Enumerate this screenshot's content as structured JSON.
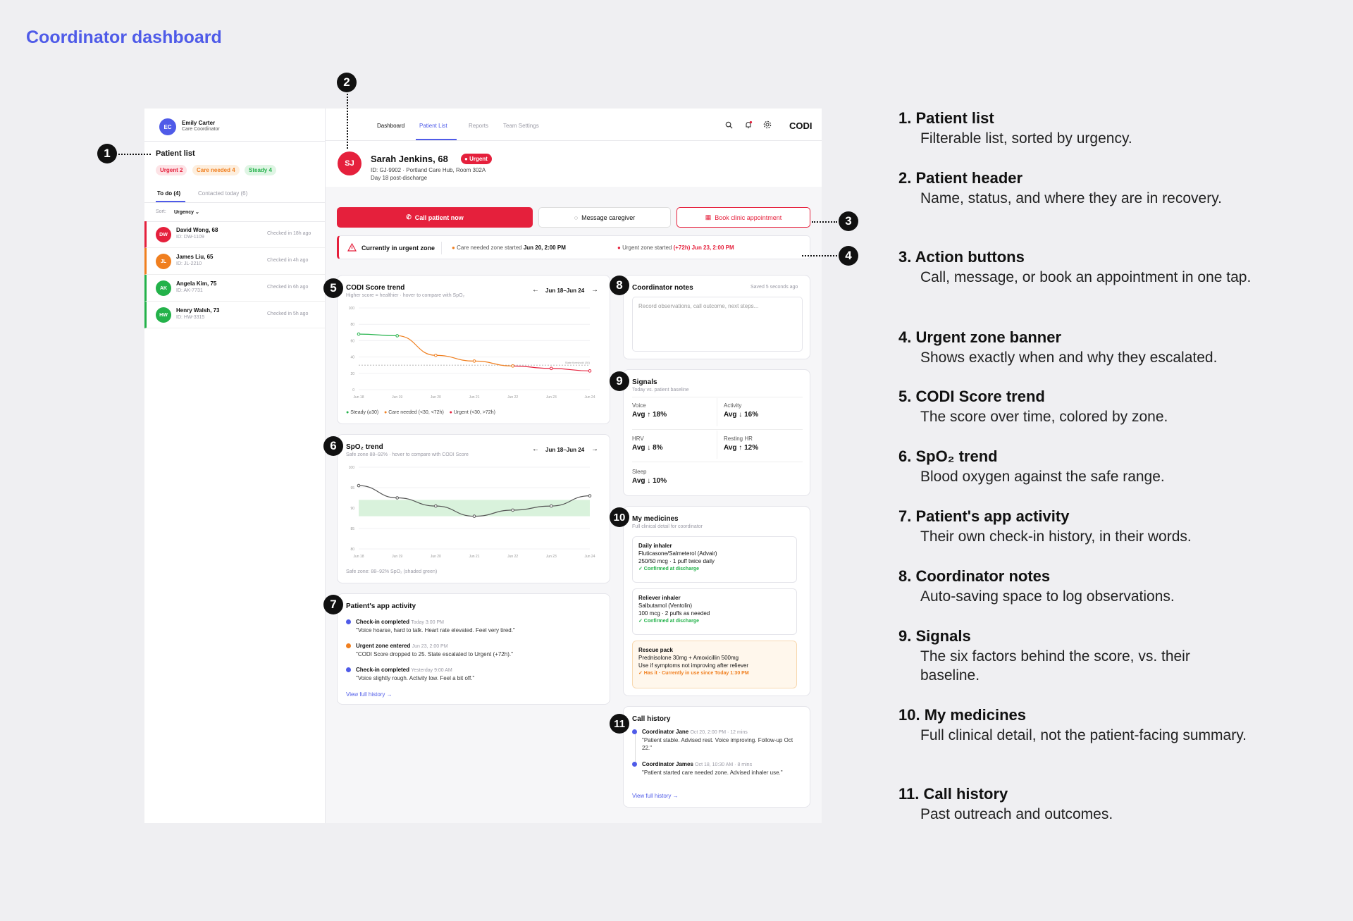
{
  "page_title": "Coordinator dashboard",
  "user": {
    "initials": "EC",
    "name": "Emily Carter",
    "role": "Care Coordinator"
  },
  "nav": {
    "tabs": [
      "Dashboard",
      "Patient List",
      "Reports",
      "Team Settings"
    ],
    "brand": "CODI"
  },
  "sidebar": {
    "title": "Patient list",
    "filters": [
      "Urgent 2",
      "Care needed 4",
      "Steady 4"
    ],
    "tabs": [
      "To do (4)",
      "Contacted today (6)"
    ],
    "sort_label": "Sort:",
    "sort_value": "Urgency",
    "patients": [
      {
        "initials": "DW",
        "name": "David Wong, 68",
        "id": "ID: DW-1109",
        "checked": "Checked in 18h ago",
        "color": "#e5203c"
      },
      {
        "initials": "JL",
        "name": "James Liu, 65",
        "id": "ID: JL-2210",
        "checked": "Checked in 4h ago",
        "color": "#f07f1f"
      },
      {
        "initials": "AK",
        "name": "Angela Kim, 75",
        "id": "ID: AK-7731",
        "checked": "Checked in 6h ago",
        "color": "#23b24a"
      },
      {
        "initials": "HW",
        "name": "Henry Walsh, 73",
        "id": "ID: HW-3315",
        "checked": "Checked in 5h ago",
        "color": "#23b24a"
      }
    ]
  },
  "patient": {
    "initials": "SJ",
    "name": "Sarah Jenkins, 68",
    "status": "Urgent",
    "id_line": "ID: GJ-9902 · Portland Care Hub, Room 302A",
    "day_line": "Day 18 post-discharge"
  },
  "actions": {
    "call": "Call patient now",
    "message": "Message caregiver",
    "book": "Book clinic appointment"
  },
  "banner": {
    "title": "Currently in urgent zone",
    "care_label": "Care needed zone started",
    "care_date": "Jun 20, 2:00 PM",
    "urgent_label": "Urgent zone started",
    "urgent_hint": "(+72h)",
    "urgent_date": "Jun 23, 2:00 PM"
  },
  "codi": {
    "title": "CODI Score trend",
    "subtitle": "Higher score = healthier · hover to compare with SpO₂",
    "range": "Jun 18–Jun 24",
    "threshold_label": "State threshold (30)",
    "legend": [
      "Steady (≥30)",
      "Care needed (<30, <72h)",
      "Urgent (<30, >72h)"
    ]
  },
  "spo2": {
    "title": "SpO₂ trend",
    "subtitle": "Safe zone 88–92% · hover to compare with CODI Score",
    "range": "Jun 18–Jun 24",
    "footer": "Safe zone: 88–92% SpO₂ (shaded green)"
  },
  "chart_data": [
    {
      "type": "line",
      "title": "CODI Score trend",
      "x": [
        "Jun 18",
        "Jun 19",
        "Jun 20",
        "Jun 21",
        "Jun 22",
        "Jun 23",
        "Jun 24"
      ],
      "x_points": [
        0,
        1,
        2,
        3,
        4,
        5,
        6
      ],
      "ylim": [
        0,
        100
      ],
      "yticks": [
        0,
        20,
        40,
        60,
        80,
        100
      ],
      "values": [
        [
          0,
          68
        ],
        [
          1,
          66
        ],
        [
          2,
          42
        ],
        [
          3,
          35
        ],
        [
          4,
          29
        ],
        [
          5,
          26
        ],
        [
          6,
          23
        ]
      ],
      "threshold": 30,
      "colors": {
        "steady": "#23b24a",
        "care": "#f07f1f",
        "urgent": "#e5203c"
      }
    },
    {
      "type": "line",
      "title": "SpO₂ trend",
      "x": [
        "Jun 18",
        "Jun 19",
        "Jun 20",
        "Jun 21",
        "Jun 22",
        "Jun 23",
        "Jun 24"
      ],
      "ylim": [
        80,
        100
      ],
      "yticks": [
        80,
        85,
        90,
        95,
        100
      ],
      "values": [
        [
          0,
          95.5
        ],
        [
          0,
          95.5
        ],
        [
          1,
          92.5
        ],
        [
          2,
          90.5
        ],
        [
          3,
          88
        ],
        [
          4,
          89.5
        ],
        [
          5,
          90.5
        ],
        [
          6,
          93
        ]
      ],
      "safe_zone": [
        88,
        92
      ]
    }
  ],
  "activity": {
    "title": "Patient's app activity",
    "items": [
      {
        "title": "Check-in completed",
        "time": "Today 3:00 PM",
        "text": "\"Voice hoarse, hard to talk. Heart rate elevated. Feel very tired.\"",
        "color": "#4f5be8"
      },
      {
        "title": "Urgent zone entered",
        "time": "Jun 23, 2:00 PM",
        "text": "\"CODI Score dropped to 25. State escalated to Urgent (+72h).\"",
        "color": "#f07f1f"
      },
      {
        "title": "Check-in completed",
        "time": "Yesterday 9:00 AM",
        "text": "\"Voice slightly rough. Activity low. Feel a bit off.\"",
        "color": "#4f5be8"
      }
    ],
    "link": "View full history →"
  },
  "notes": {
    "title": "Coordinator notes",
    "saved": "Saved 5 seconds ago",
    "placeholder": "Record observations, call outcome, next steps..."
  },
  "signals": {
    "title": "Signals",
    "subtitle": "Today vs. patient baseline",
    "items": [
      {
        "label": "Voice",
        "value": "Avg ↑ 18%"
      },
      {
        "label": "Activity",
        "value": "Avg ↓ 16%"
      },
      {
        "label": "HRV",
        "value": "Avg ↓ 8%"
      },
      {
        "label": "Resting HR",
        "value": "Avg ↑ 12%"
      },
      {
        "label": "Sleep",
        "value": "Avg ↓ 10%"
      }
    ]
  },
  "medicines": {
    "title": "My medicines",
    "subtitle": "Full clinical detail for coordinator",
    "items": [
      {
        "name": "Daily inhaler",
        "drug": "Fluticasone/Salmeterol (Advair)",
        "dose": "250/50 mcg · 1 puff twice daily",
        "status": "✓ Confirmed at discharge"
      },
      {
        "name": "Reliever inhaler",
        "drug": "Salbutamol (Ventolin)",
        "dose": "100 mcg · 2 puffs as needed",
        "status": "✓ Confirmed at discharge"
      },
      {
        "name": "Rescue pack",
        "drug": "Prednisolone 30mg + Amoxicillin 500mg",
        "dose": "Use if symptoms not improving after reliever",
        "status": "✓ Has it · Currently in use since Today 1:30 PM"
      }
    ]
  },
  "calls": {
    "title": "Call history",
    "items": [
      {
        "who": "Coordinator Jane",
        "meta": "Oct 20, 2:00 PM · 12 mins",
        "text": "\"Patient stable. Advised rest. Voice improving. Follow-up Oct 22.\""
      },
      {
        "who": "Coordinator James",
        "meta": "Oct 18, 10:30 AM · 8 mins",
        "text": "\"Patient started care needed zone. Advised inhaler use.\""
      }
    ],
    "link": "View full history →"
  },
  "callouts": [
    "1",
    "2",
    "3",
    "4",
    "5",
    "6",
    "7",
    "8",
    "9",
    "10",
    "11"
  ],
  "legend": [
    {
      "t": "1. Patient list",
      "d": "Filterable list, sorted by urgency."
    },
    {
      "t": "2. Patient header",
      "d": "Name, status, and where they are in recovery."
    },
    {
      "t": "3. Action buttons",
      "d": "Call, message, or book an appointment in one tap."
    },
    {
      "t": "4. Urgent zone banner",
      "d": "Shows exactly when and why they escalated."
    },
    {
      "t": "5. CODI Score trend",
      "d": "The score over time, colored by zone."
    },
    {
      "t": "6. SpO₂ trend",
      "d": "Blood oxygen against the safe range."
    },
    {
      "t": "7. Patient's app activity",
      "d": "Their own check-in history, in their words."
    },
    {
      "t": "8. Coordinator notes",
      "d": "Auto-saving space to log observations."
    },
    {
      "t": "9. Signals",
      "d": "The six factors behind the score, vs. their baseline."
    },
    {
      "t": "10. My medicines",
      "d": "Full clinical detail, not the patient-facing summary."
    },
    {
      "t": "11. Call history",
      "d": "Past outreach and outcomes."
    }
  ]
}
